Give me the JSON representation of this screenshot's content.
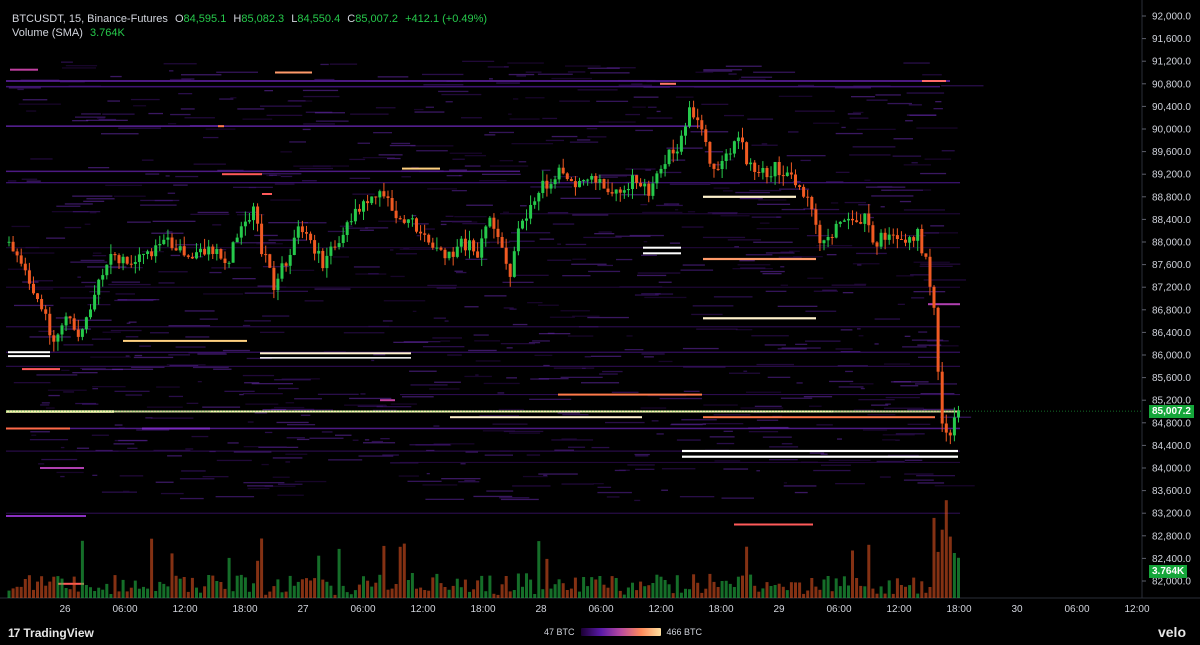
{
  "header": {
    "symbol_line": "BTCUSDT, 15, Binance-Futures",
    "open_label": "O",
    "open": "84,595.1",
    "high_label": "H",
    "high": "85,082.3",
    "low_label": "L",
    "low": "84,550.4",
    "close_label": "C",
    "close": "85,007.2",
    "change": "+412.1 (+0.49%)",
    "volume_label": "Volume (SMA)",
    "volume_value": "3.764K"
  },
  "price_tag": "85,007.2",
  "volume_tag": "3.764K",
  "footer": {
    "brand": "TradingView",
    "brand_mark": "17",
    "scale_min": "47 BTC",
    "scale_max": "466 BTC",
    "brand_right": "velo"
  },
  "colors": {
    "up": "#26c94b",
    "down": "#f05a22",
    "bg": "#000000",
    "axis_text": "#d1d4dc",
    "price_tag": "#15a63a"
  },
  "chart_data": {
    "type": "candlestick",
    "ylim": [
      81600,
      92000
    ],
    "xlim_label": "Mar 25 19:00 – Mar 30 12:00",
    "y_ticks": [
      "92,000.0",
      "91,600.0",
      "91,200.0",
      "90,800.0",
      "90,400.0",
      "90,000.0",
      "89,600.0",
      "89,200.0",
      "88,800.0",
      "88,400.0",
      "88,000.0",
      "87,600.0",
      "87,200.0",
      "86,800.0",
      "86,400.0",
      "86,000.0",
      "85,600.0",
      "85,200.0",
      "84,800.0",
      "84,400.0",
      "84,000.0",
      "83,600.0",
      "83,200.0",
      "82,800.0",
      "82,400.0",
      "82,000.0"
    ],
    "x_ticks": [
      "26",
      "06:00",
      "12:00",
      "18:00",
      "27",
      "06:00",
      "12:00",
      "18:00",
      "28",
      "06:00",
      "12:00",
      "18:00",
      "29",
      "06:00",
      "12:00",
      "18:00",
      "30",
      "06:00",
      "12:00"
    ],
    "price_path": [
      [
        0,
        88000
      ],
      [
        5,
        87400
      ],
      [
        9,
        86800
      ],
      [
        12,
        86300
      ],
      [
        15,
        86600
      ],
      [
        18,
        86400
      ],
      [
        22,
        87100
      ],
      [
        26,
        87700
      ],
      [
        30,
        87600
      ],
      [
        35,
        87800
      ],
      [
        40,
        88000
      ],
      [
        45,
        87800
      ],
      [
        50,
        87900
      ],
      [
        55,
        87700
      ],
      [
        58,
        88200
      ],
      [
        61,
        88600
      ],
      [
        63,
        87900
      ],
      [
        66,
        87200
      ],
      [
        69,
        87700
      ],
      [
        72,
        88200
      ],
      [
        75,
        88000
      ],
      [
        78,
        87600
      ],
      [
        81,
        87900
      ],
      [
        84,
        88400
      ],
      [
        88,
        88600
      ],
      [
        92,
        88800
      ],
      [
        96,
        88500
      ],
      [
        100,
        88300
      ],
      [
        104,
        88100
      ],
      [
        108,
        87700
      ],
      [
        112,
        88000
      ],
      [
        116,
        87800
      ],
      [
        119,
        88400
      ],
      [
        121,
        88200
      ],
      [
        124,
        87400
      ],
      [
        126,
        88200
      ],
      [
        129,
        88700
      ],
      [
        132,
        89000
      ],
      [
        136,
        89200
      ],
      [
        140,
        89100
      ],
      [
        145,
        89100
      ],
      [
        150,
        88900
      ],
      [
        154,
        89100
      ],
      [
        158,
        88900
      ],
      [
        162,
        89500
      ],
      [
        165,
        89700
      ],
      [
        168,
        90400
      ],
      [
        171,
        90100
      ],
      [
        173,
        89300
      ],
      [
        177,
        89500
      ],
      [
        180,
        89900
      ],
      [
        182,
        89500
      ],
      [
        185,
        89200
      ],
      [
        189,
        89300
      ],
      [
        193,
        89100
      ],
      [
        197,
        88700
      ],
      [
        200,
        88000
      ],
      [
        203,
        88200
      ],
      [
        207,
        88300
      ],
      [
        211,
        88400
      ],
      [
        213,
        88000
      ],
      [
        217,
        88100
      ],
      [
        221,
        88000
      ],
      [
        224,
        88100
      ],
      [
        226,
        87700
      ],
      [
        228,
        86900
      ],
      [
        229,
        85600
      ],
      [
        230,
        84800
      ],
      [
        231,
        84500
      ],
      [
        232,
        84700
      ],
      [
        233,
        85007
      ]
    ],
    "last_close": 85007.2,
    "volume_last": "3.764K",
    "heatmap_scale": [
      "47 BTC",
      "466 BTC"
    ]
  }
}
